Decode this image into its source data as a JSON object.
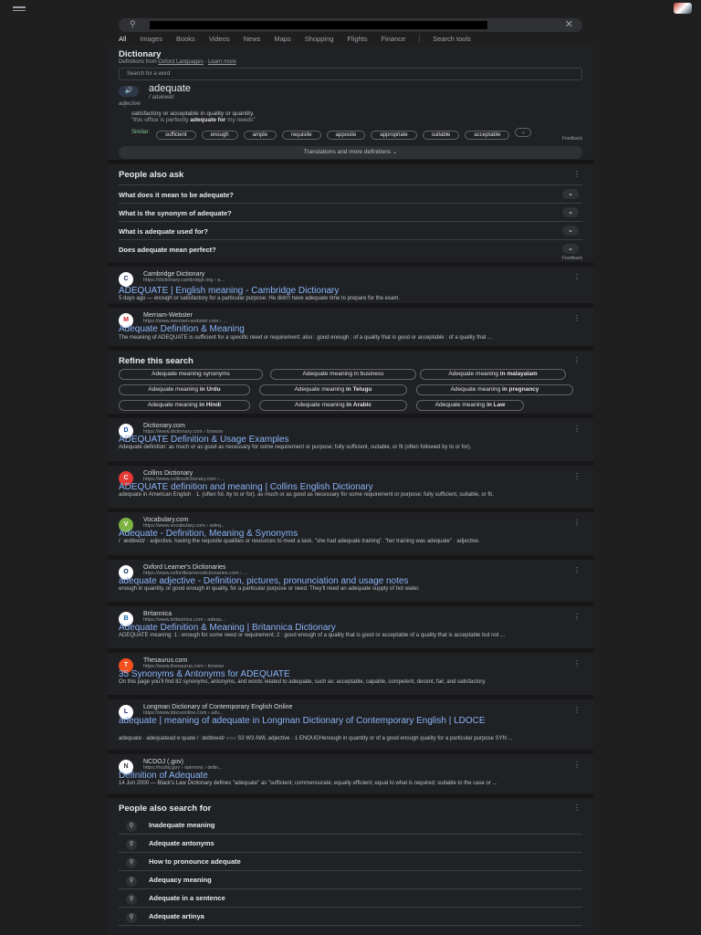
{
  "header": {
    "search_query": "",
    "clear_icon": "close-icon"
  },
  "tabs": [
    "All",
    "Images",
    "Books",
    "Videos",
    "News",
    "Maps",
    "Shopping",
    "Flights",
    "Finance"
  ],
  "search_tools": "Search tools",
  "dictionary": {
    "title": "Dictionary",
    "source_prefix": "Definitions from",
    "source": "Oxford Languages",
    "learn_more": "Learn more",
    "search_placeholder": "Search for a word",
    "word": "adequate",
    "phonetic": "/ˈadəkwət/",
    "pos": "adjective",
    "definition": "satisfactory or acceptable in quality or quantity.",
    "example_pre": "\"this office is perfectly ",
    "example_bold": "adequate for",
    "example_post": " my needs\"",
    "similar_label": "Similar:",
    "similar": [
      "sufficient",
      "enough",
      "ample",
      "requisite",
      "apposite",
      "appropriate",
      "suitable",
      "acceptable"
    ],
    "feedback": "Feedback",
    "translations": "Translations and more definitions"
  },
  "paa": {
    "title": "People also ask",
    "questions": [
      "What does it mean to be adequate?",
      "What is the synonym of adequate?",
      "What is adequate used for?",
      "Does adequate mean perfect?"
    ],
    "feedback": "Feedback"
  },
  "results1": [
    {
      "site": "Cambridge Dictionary",
      "url": "https://dictionary.cambridge.org › a...",
      "title": "ADEQUATE | English meaning - Cambridge Dictionary",
      "snippet": "5 days ago — enough or satisfactory for a particular purpose: He didn't have adequate time to prepare for the exam.",
      "fav": "C",
      "favbg": "#ffffff",
      "favfg": "#1d2a5b"
    },
    {
      "site": "Merriam-Webster",
      "url": "https://www.merriam-webster.com › ...",
      "title": "Adequate Definition & Meaning",
      "snippet": "The meaning of ADEQUATE is sufficient for a specific need or requirement; also : good enough : of a quality that is good or acceptable : of a quality that ...",
      "fav": "M",
      "favbg": "#ffffff",
      "favfg": "#d71920"
    }
  ],
  "refine": {
    "title": "Refine this search",
    "chips": [
      {
        "pre": "Adequate meaning synonyms",
        "bold": ""
      },
      {
        "pre": "Adequate meaning in business",
        "bold": ""
      },
      {
        "pre": "Adequate meaning ",
        "bold": "in malayalam"
      },
      {
        "pre": "Adequate meaning ",
        "bold": "in Urdu"
      },
      {
        "pre": "Adequate meaning ",
        "bold": "in Telugu"
      },
      {
        "pre": "Adequate meaning ",
        "bold": "in pregnancy"
      },
      {
        "pre": "Adequate meaning ",
        "bold": "in Hindi"
      },
      {
        "pre": "Adequate meaning ",
        "bold": "in Arabic"
      },
      {
        "pre": "Adequate meaning ",
        "bold": "in Law"
      }
    ]
  },
  "results2": [
    {
      "site": "Dictionary.com",
      "url": "https://www.dictionary.com › browse",
      "title": "ADEQUATE Definition & Usage Examples",
      "snippet": "Adequate definition: as much or as good as necessary for some requirement or purpose; fully sufficient, suitable, or fit (often followed by to or for).",
      "fav": "D",
      "favbg": "#ffffff",
      "favfg": "#0c4da2"
    },
    {
      "site": "Collins Dictionary",
      "url": "https://www.collinsdictionary.com › ...",
      "title": "ADEQUATE definition and meaning | Collins English Dictionary",
      "snippet": "adequate in American English · 1. (often fol. by to or for). as much or as good as necessary for some requirement or purpose; fully sufficient, suitable, or fit.",
      "fav": "C",
      "favbg": "#e53935",
      "favfg": "#ffffff"
    },
    {
      "site": "Vocabulary.com",
      "url": "https://www.vocabulary.com › adeq...",
      "title": "Adequate - Definition, Meaning & Synonyms",
      "snippet": "/ ˈædɪkwɪt/ · adjective. having the requisite qualities or resources to meet a task. \"she had adequate training\". \"her training was adequate\" · adjective.",
      "fav": "V",
      "favbg": "#7cb342",
      "favfg": "#ffffff"
    },
    {
      "site": "Oxford Learner's Dictionaries",
      "url": "https://www.oxfordlearnersdictionaries.com › ...",
      "title": "adequate adjective - Definition, pictures, pronunciation and usage notes",
      "snippet": "enough in quantity, or good enough in quality, for a particular purpose or need. They'll need an adequate supply of hot water.",
      "fav": "O",
      "favbg": "#ffffff",
      "favfg": "#002147"
    },
    {
      "site": "Britannica",
      "url": "https://www.britannica.com › adequ...",
      "title": "Adequate Definition & Meaning | Britannica Dictionary",
      "snippet": "ADEQUATE meaning: 1 : enough for some need or requirement; 2 : good enough of a quality that is good or acceptable of a quality that is acceptable but not ...",
      "fav": "B",
      "favbg": "#ffffff",
      "favfg": "#0a63a6"
    },
    {
      "site": "Thesaurus.com",
      "url": "https://www.thesaurus.com › browse",
      "title": "35 Synonyms & Antonyms for ADEQUATE",
      "snippet": "On this page you'll find 82 synonyms, antonyms, and words related to adequate, such as: acceptable, capable, competent, decent, fair, and satisfactory.",
      "fav": "T",
      "favbg": "#f4511e",
      "favfg": "#ffffff"
    },
    {
      "site": "Longman Dictionary of Contemporary English Online",
      "url": "https://www.ldoceonline.com › adv...",
      "title": "adequate | meaning of adequate in Longman Dictionary of Contemporary English | LDOCE",
      "snippet": "adequate · adequatead‧e‧quate / ˈædɪkwət/ ○○○ S3 W3 AWL adjective · 1 ENOUGHenough in quantity or of a good enough quality for a particular purpose SYN ...",
      "fav": "L",
      "favbg": "#ffffff",
      "favfg": "#1a237e"
    },
    {
      "site": "NCDOJ (.gov)",
      "url": "https://ncdoj.gov › opinions › defin...",
      "title": "Definition of Adequate",
      "snippet": "14 Jun 2000 — Black's Law Dictionary defines \"adequate\" as \"sufficient; commensurate; equally efficient; equal to what is required; suitable to the case or ...",
      "fav": "N",
      "favbg": "#ffffff",
      "favfg": "#333333"
    }
  ],
  "pas": {
    "title": "People also search for",
    "items": [
      "Inadequate meaning",
      "Adequate antonyms",
      "How to pronounce adequate",
      "Adequacy meaning",
      "Adequate in a sentence",
      "Adequate artinya"
    ]
  }
}
